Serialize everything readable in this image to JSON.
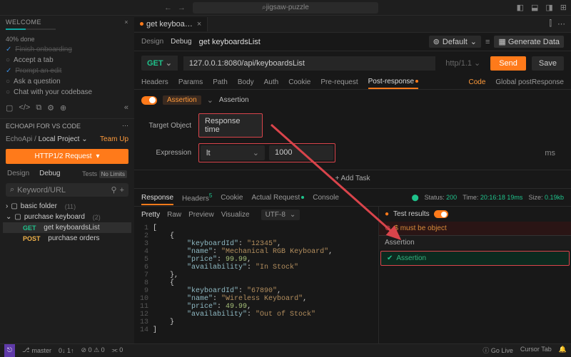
{
  "titlebar": {
    "search_placeholder": "jigsaw-puzzle"
  },
  "welcome": {
    "header": "WELCOME",
    "progress": "40% done",
    "items": [
      {
        "label": "Finish onboarding",
        "done": true
      },
      {
        "label": "Accept a tab",
        "done": false
      },
      {
        "label": "Prompt an edit",
        "done": true
      },
      {
        "label": "Ask a question",
        "done": false
      },
      {
        "label": "Chat with your codebase",
        "done": false
      }
    ]
  },
  "echo": {
    "header": "ECHOAPI FOR VS CODE",
    "project_prefix": "EchoApi /",
    "project_name": "Local Project",
    "teamup": "Team Up",
    "new_request": "HTTP1/2 Request",
    "tabs": {
      "design": "Design",
      "debug": "Debug",
      "tests": "Tests",
      "tests_badge": "No Limits"
    },
    "search_placeholder": "Keyword/URL"
  },
  "tree": {
    "folders": [
      {
        "name": "basic folder",
        "count": 11
      },
      {
        "name": "purchase keyboard",
        "count": 2
      }
    ],
    "items": [
      {
        "method": "GET",
        "name": "get keyboardsList"
      },
      {
        "method": "POST",
        "name": "purchase orders"
      }
    ]
  },
  "request": {
    "tab_title": "get keyboa…",
    "modes": {
      "design": "Design",
      "debug": "Debug"
    },
    "title": "get keyboardsList",
    "env": "Default",
    "gen": "Generate Data",
    "method": "GET",
    "url": "127.0.0.1:8080/api/keyboardsList",
    "protocol": "http/1.1",
    "send": "Send",
    "save": "Save",
    "tabs": [
      "Headers",
      "Params",
      "Path",
      "Body",
      "Auth",
      "Cookie",
      "Pre-request",
      "Post-response"
    ],
    "right_links": {
      "code": "Code",
      "global": "Global postResponse"
    },
    "assert": {
      "pill": "Assertion",
      "text": "Assertion"
    },
    "target_label": "Target Object",
    "target_value": "Response time",
    "expr_label": "Expression",
    "expr_op": "lt",
    "expr_val": "1000",
    "expr_unit": "ms",
    "add_task": "+  Add Task"
  },
  "response": {
    "tabs": {
      "response": "Response",
      "headers": "Headers",
      "headers_count": "5",
      "cookie": "Cookie",
      "actual": "Actual Request",
      "console": "Console"
    },
    "status_label": "Status:",
    "status_code": "200",
    "time_label": "Time:",
    "time_val": "20:16:18 19ms",
    "size_label": "Size:",
    "size_val": "0.19kb",
    "views": [
      "Pretty",
      "Raw",
      "Preview",
      "Visualize"
    ],
    "encoding": "UTF-8",
    "code_lines": [
      "[",
      "    {",
      "        \"keyboardId\": \"12345\",",
      "        \"name\": \"Mechanical RGB Keyboard\",",
      "        \"price\": 99.99,",
      "        \"availability\": \"In Stock\"",
      "    },",
      "    {",
      "        \"keyboardId\": \"67890\",",
      "        \"name\": \"Wireless Keyboard\",",
      "        \"price\": 49.99,",
      "        \"availability\": \"Out of Stock\"",
      "    }",
      "]"
    ],
    "test_results": {
      "header": "Test results",
      "error": "$ must be object",
      "section": "Assertion",
      "pass": "Assertion"
    }
  },
  "statusbar": {
    "branch": "master",
    "sync": "0↓ 1↑",
    "problems": "⊘ 0  ⚠ 0",
    "ports": "⫘ 0",
    "golive": "Go Live",
    "cursor": "Cursor Tab"
  }
}
